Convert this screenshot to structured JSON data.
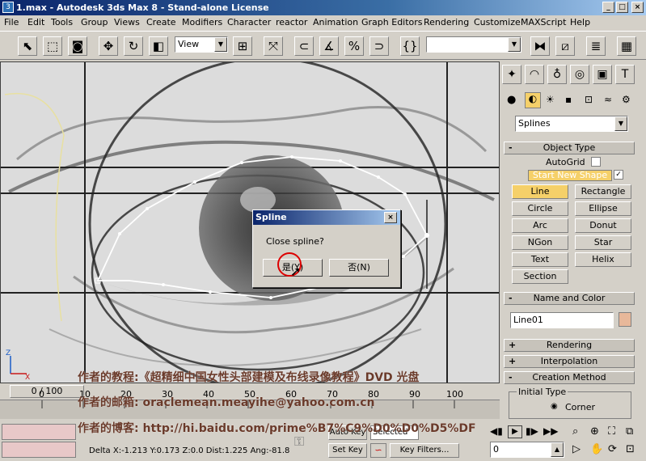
{
  "window": {
    "title": "1.max - Autodesk 3ds Max 8 - Stand-alone License",
    "controls": [
      "_",
      "□",
      "×"
    ]
  },
  "menu": [
    "File",
    "Edit",
    "Tools",
    "Group",
    "Views",
    "Create",
    "Modifiers",
    "Character",
    "reactor",
    "Animation",
    "Graph Editors",
    "Rendering",
    "Customize",
    "MAXScript",
    "Help"
  ],
  "toolbar": {
    "view_select": "View",
    "selection_set_placeholder": ""
  },
  "command_panel": {
    "category_dropdown": "Splines",
    "object_type": {
      "header": "Object Type",
      "autogrid_label": "AutoGrid",
      "start_new_shape": "Start New Shape",
      "buttons": [
        "Line",
        "Rectangle",
        "Circle",
        "Ellipse",
        "Arc",
        "Donut",
        "NGon",
        "Star",
        "Text",
        "Helix",
        "Section"
      ]
    },
    "name_and_color": {
      "header": "Name and Color",
      "name_value": "Line01"
    },
    "rollouts": [
      "Rendering",
      "Interpolation",
      "Creation Method"
    ],
    "initial_type": {
      "label": "Initial Type",
      "option": "Corner"
    }
  },
  "dialog": {
    "title": "Spline",
    "message": "Close spline?",
    "yes_label": "是(Y)",
    "no_label": "否(N)"
  },
  "overlay_text": {
    "line1": "作者的教程:《超精细中国女性头部建模及布线录像教程》DVD 光盘",
    "line2": "作者的邮箱: oraclemean.meayihe@yahoo.com.cn",
    "line3": "作者的博客: http://hi.baidu.com/prime%B7%C9%D0%D0%D5%DF"
  },
  "timeline": {
    "frame_counter": "0 / 100",
    "ticks": [
      "0",
      "10",
      "20",
      "30",
      "40",
      "50",
      "60",
      "70",
      "80",
      "90",
      "100"
    ]
  },
  "status": {
    "delta_x": "Delta X:-1.213",
    "y": "Y:0.173",
    "z": "Z:0.0",
    "dist": "Dist:1.225",
    "ang": "Ang:-81.8",
    "auto_key": "Auto Key",
    "selected": "Selected",
    "set_key": "Set Key",
    "key_filters": "Key Filters...",
    "frame_value": "0"
  },
  "colors": {
    "title_start": "#0a246a",
    "title_end": "#a6caf0",
    "active_button": "#f5d069",
    "object_color_swatch": "#e8b89a"
  }
}
